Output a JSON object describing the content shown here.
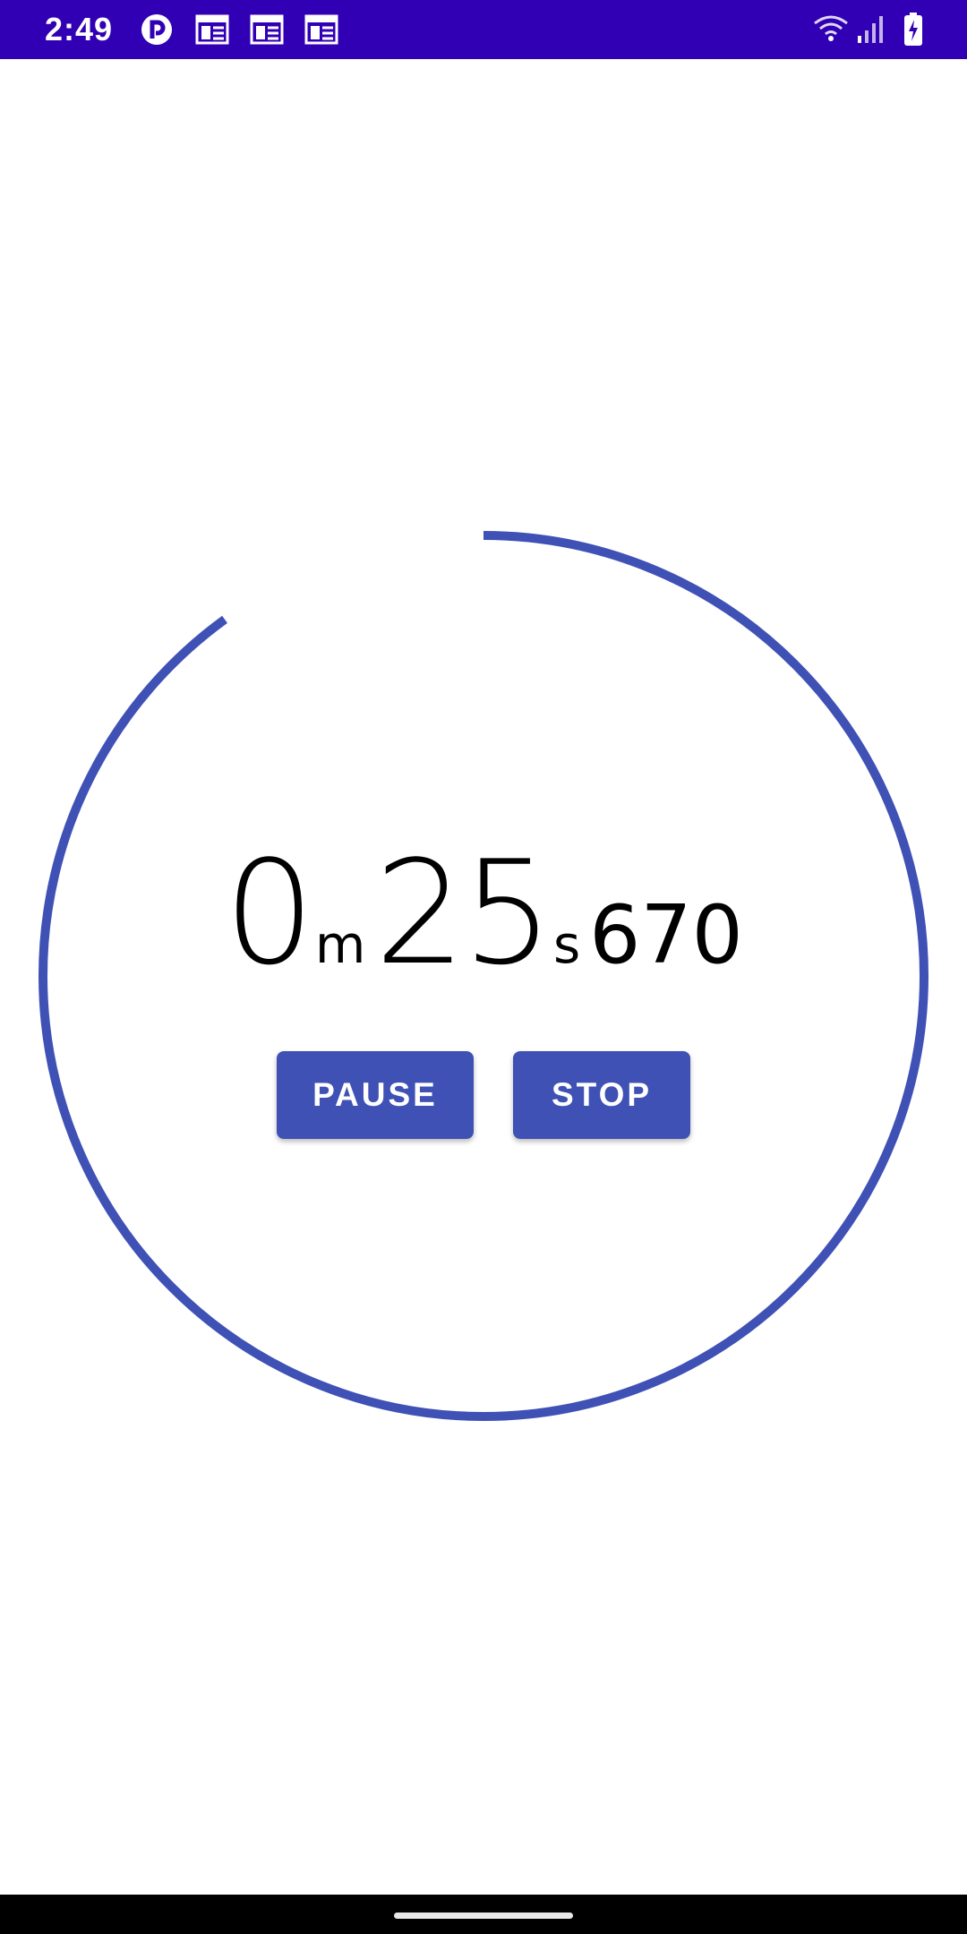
{
  "status_bar": {
    "time": "2:49",
    "left_icons": [
      "pocket-casts-icon",
      "calendar-icon",
      "calendar-icon",
      "calendar-icon"
    ],
    "right_icons": [
      "wifi-icon",
      "signal-icon",
      "battery-charging-icon"
    ],
    "background_color": "#3200b4"
  },
  "timer": {
    "minutes": "0",
    "minutes_unit": "m",
    "seconds": "25",
    "seconds_unit": "s",
    "milliseconds": "670",
    "progress_fraction": 0.9
  },
  "buttons": {
    "pause_label": "PAUSE",
    "stop_label": "STOP"
  },
  "colors": {
    "accent": "#3f51b5"
  }
}
